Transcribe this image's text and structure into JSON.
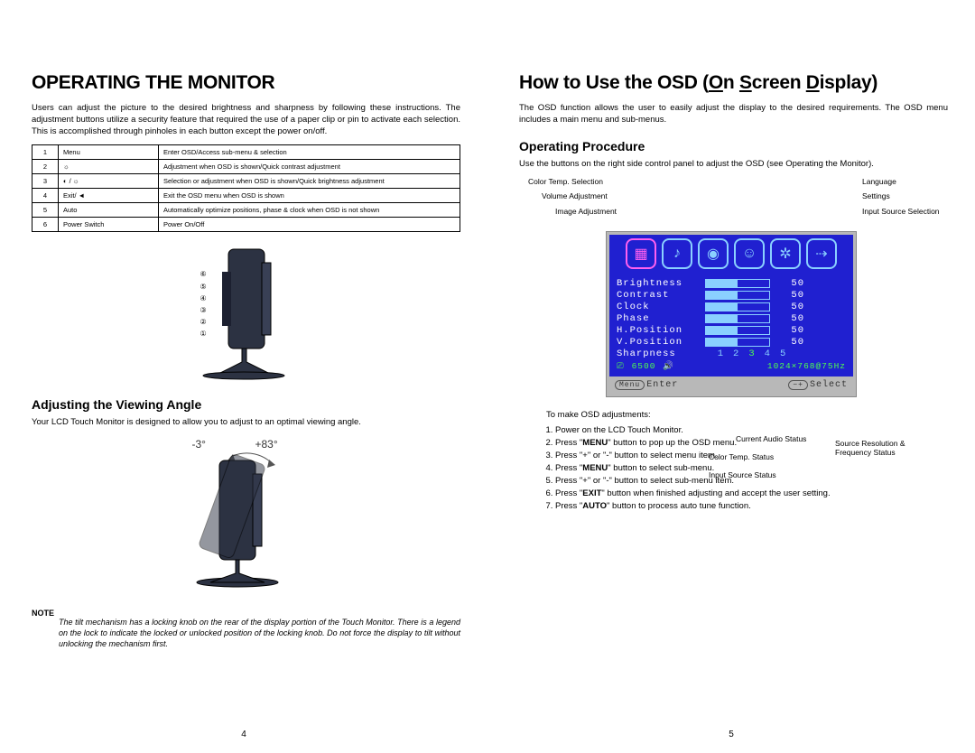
{
  "left": {
    "title": "OPERATING THE MONITOR",
    "intro": "Users can adjust the picture to the desired brightness and sharpness by following these instructions. The adjustment buttons utilize a security feature that required the use of a paper clip or pin to activate each selection.  This is accomplished through pinholes in each button except the power on/off.",
    "table": [
      {
        "n": "1",
        "label": "Menu",
        "desc": "Enter OSD/Access sub-menu & selection"
      },
      {
        "n": "2",
        "label": "☼",
        "desc": "Adjustment when OSD is shown/Quick contrast adjustment"
      },
      {
        "n": "3",
        "label": "◐ / ☼",
        "desc": "Selection or adjustment when OSD is shown/Quick brightness adjustment"
      },
      {
        "n": "4",
        "label": "Exit/ ◄",
        "desc": "Exit the OSD menu when OSD is shown"
      },
      {
        "n": "5",
        "label": "Auto",
        "desc": "Automatically optimize positions, phase & clock when OSD is not shown"
      },
      {
        "n": "6",
        "label": "Power Switch",
        "desc": "Power On/Off"
      }
    ],
    "adj_title": "Adjusting the Viewing Angle",
    "adj_text": "Your LCD Touch Monitor is designed to allow you to adjust to an optimal viewing angle.",
    "tilt_neg": "-3°",
    "tilt_pos": "+83°",
    "note_label": "NOTE",
    "note_text": "The tilt mechanism has a locking knob on the rear of the display portion of the Touch Monitor.  There is a legend on the lock to indicate the locked or unlocked position of the locking knob.  Do not force the display to tilt without unlocking the mechanism first.",
    "pagenum": "4",
    "markers": {
      "m1": "①",
      "m2": "②",
      "m3": "③",
      "m4": "④",
      "m5": "⑤",
      "m6": "⑥"
    }
  },
  "right": {
    "title_pre": "How to Use the OSD (",
    "title_o": "O",
    "title_n": "n ",
    "title_s": "S",
    "title_creen": "creen ",
    "title_d": "D",
    "title_isplay": "isplay)",
    "intro": "The OSD function allows the user to easily adjust the display to the desired requirements. The OSD menu includes a main menu and sub-menus.",
    "op_title": "Operating Procedure",
    "op_text": "Use the buttons on the right side control panel to adjust the OSD (see Operating the Monitor).",
    "callouts": {
      "color_temp": "Color Temp. Selection",
      "volume": "Volume Adjustment",
      "image": "Image Adjustment",
      "language": "Language",
      "settings": "Settings",
      "input_sel": "Input Source Selection",
      "cur_audio": "Current Audio Status",
      "ct_status": "Color Temp. Status",
      "src_status": "Input Source Status",
      "res_status": "Source Resolution & Frequency Status"
    },
    "osd": {
      "rows": [
        {
          "name": "Brightness",
          "val": "50"
        },
        {
          "name": "Contrast",
          "val": "50"
        },
        {
          "name": "Clock",
          "val": "50"
        },
        {
          "name": "Phase",
          "val": "50"
        },
        {
          "name": "H.Position",
          "val": "50"
        },
        {
          "name": "V.Position",
          "val": "50"
        }
      ],
      "sharp": "Sharpness",
      "sharp_nums": [
        "1",
        "2",
        "3",
        "4",
        "5"
      ],
      "status_src": "⎚",
      "status_ct": "6500",
      "status_audio": "🔊",
      "status_res": "1024×768@75Hz",
      "footer_enter": "Enter",
      "footer_select": "Select",
      "footer_menu_btn": "Menu",
      "footer_sel_btn": "−+"
    },
    "steps_intro": "To make OSD adjustments:",
    "steps": [
      "Power on the LCD Touch Monitor.",
      "Press \"MENU\" button to pop up the OSD menu.",
      "Press \"+\" or \"-\" button to select menu item.",
      "Press \"MENU\" button to select sub-menu.",
      "Press \"+\" or \"-\" button to select sub-menu item.",
      "Press \"EXIT\" button when finished adjusting and accept the user setting.",
      "Press \"AUTO\" button to process auto tune function."
    ],
    "pagenum": "5"
  }
}
